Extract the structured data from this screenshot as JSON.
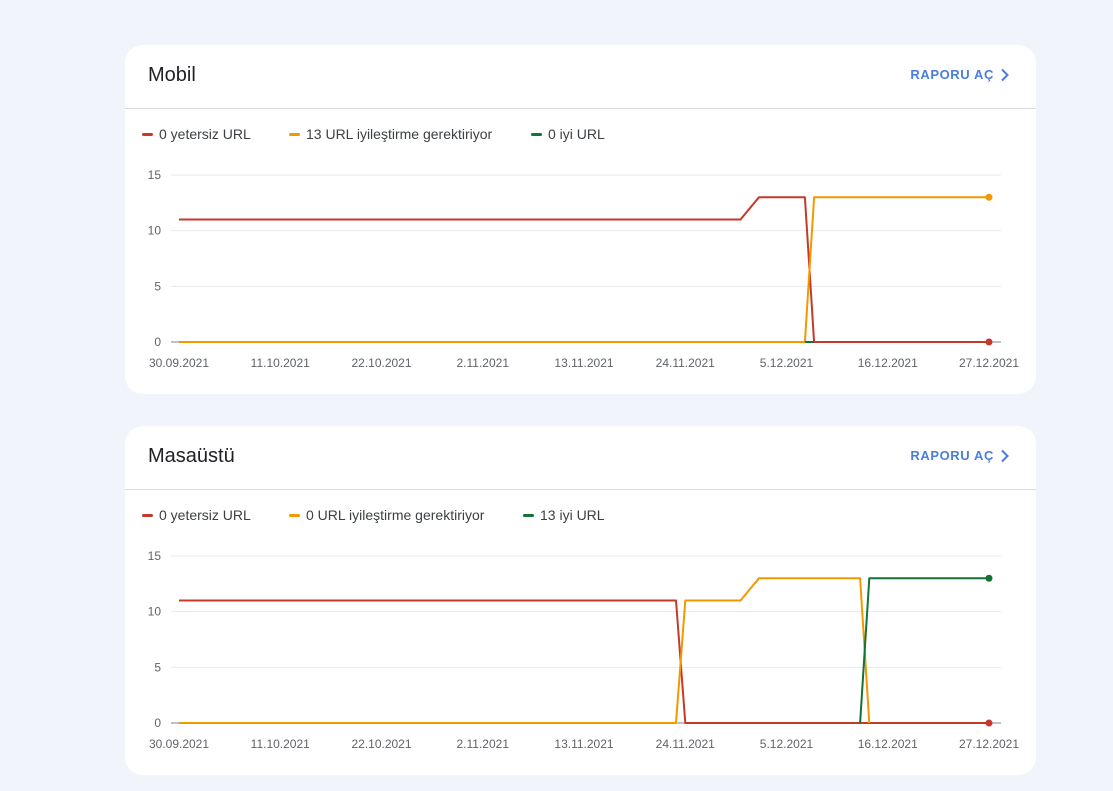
{
  "colors": {
    "poor": "#c5392b",
    "needs": "#f29900",
    "good": "#137333"
  },
  "icons": {
    "report_link": "chevron-right-icon"
  },
  "cards": [
    {
      "title": "Mobil",
      "report_label": "RAPORU AÇ",
      "legend": [
        "0 yetersiz URL",
        "13 URL iyileştirme gerektiriyor",
        "0 iyi URL"
      ],
      "chart_data": {
        "type": "line",
        "x_tick_labels": [
          "30.09.2021",
          "11.10.2021",
          "22.10.2021",
          "2.11.2021",
          "13.11.2021",
          "24.11.2021",
          "5.12.2021",
          "16.12.2021",
          "27.12.2021"
        ],
        "y_ticks": [
          0,
          5,
          10,
          15
        ],
        "ylim": [
          0,
          15
        ],
        "xlim_days": [
          0,
          88
        ],
        "grid": true,
        "series": [
          {
            "name": "0 yetersiz URL",
            "color": "#c5392b",
            "points": [
              [
                0,
                11
              ],
              [
                61,
                11
              ],
              [
                63,
                13
              ],
              [
                68,
                13
              ],
              [
                69,
                0
              ],
              [
                88,
                0
              ]
            ],
            "end_marker": true
          },
          {
            "name": "13 URL iyileştirme gerektiriyor",
            "color": "#f29900",
            "points": [
              [
                0,
                0
              ],
              [
                68,
                0
              ],
              [
                69,
                13
              ],
              [
                88,
                13
              ]
            ],
            "end_marker": true
          },
          {
            "name": "0 iyi URL",
            "color": "#137333",
            "points": [
              [
                68,
                0
              ],
              [
                69,
                0
              ]
            ],
            "end_marker": false
          }
        ]
      }
    },
    {
      "title": "Masaüstü",
      "report_label": "RAPORU AÇ",
      "legend": [
        "0 yetersiz URL",
        "0 URL iyileştirme gerektiriyor",
        "13 iyi URL"
      ],
      "chart_data": {
        "type": "line",
        "x_tick_labels": [
          "30.09.2021",
          "11.10.2021",
          "22.10.2021",
          "2.11.2021",
          "13.11.2021",
          "24.11.2021",
          "5.12.2021",
          "16.12.2021",
          "27.12.2021"
        ],
        "y_ticks": [
          0,
          5,
          10,
          15
        ],
        "ylim": [
          0,
          15
        ],
        "xlim_days": [
          0,
          88
        ],
        "grid": true,
        "series": [
          {
            "name": "0 yetersiz URL",
            "color": "#c5392b",
            "points": [
              [
                0,
                11
              ],
              [
                54,
                11
              ],
              [
                55,
                0
              ],
              [
                88,
                0
              ]
            ],
            "end_marker": true
          },
          {
            "name": "0 URL iyileştirme gerektiriyor",
            "color": "#f29900",
            "points": [
              [
                0,
                0
              ],
              [
                54,
                0
              ],
              [
                55,
                11
              ],
              [
                61,
                11
              ],
              [
                63,
                13
              ],
              [
                74,
                13
              ],
              [
                75,
                0
              ]
            ],
            "end_marker": false
          },
          {
            "name": "13 iyi URL",
            "color": "#137333",
            "points": [
              [
                74,
                0
              ],
              [
                75,
                13
              ],
              [
                88,
                13
              ]
            ],
            "end_marker": true
          }
        ]
      }
    }
  ]
}
